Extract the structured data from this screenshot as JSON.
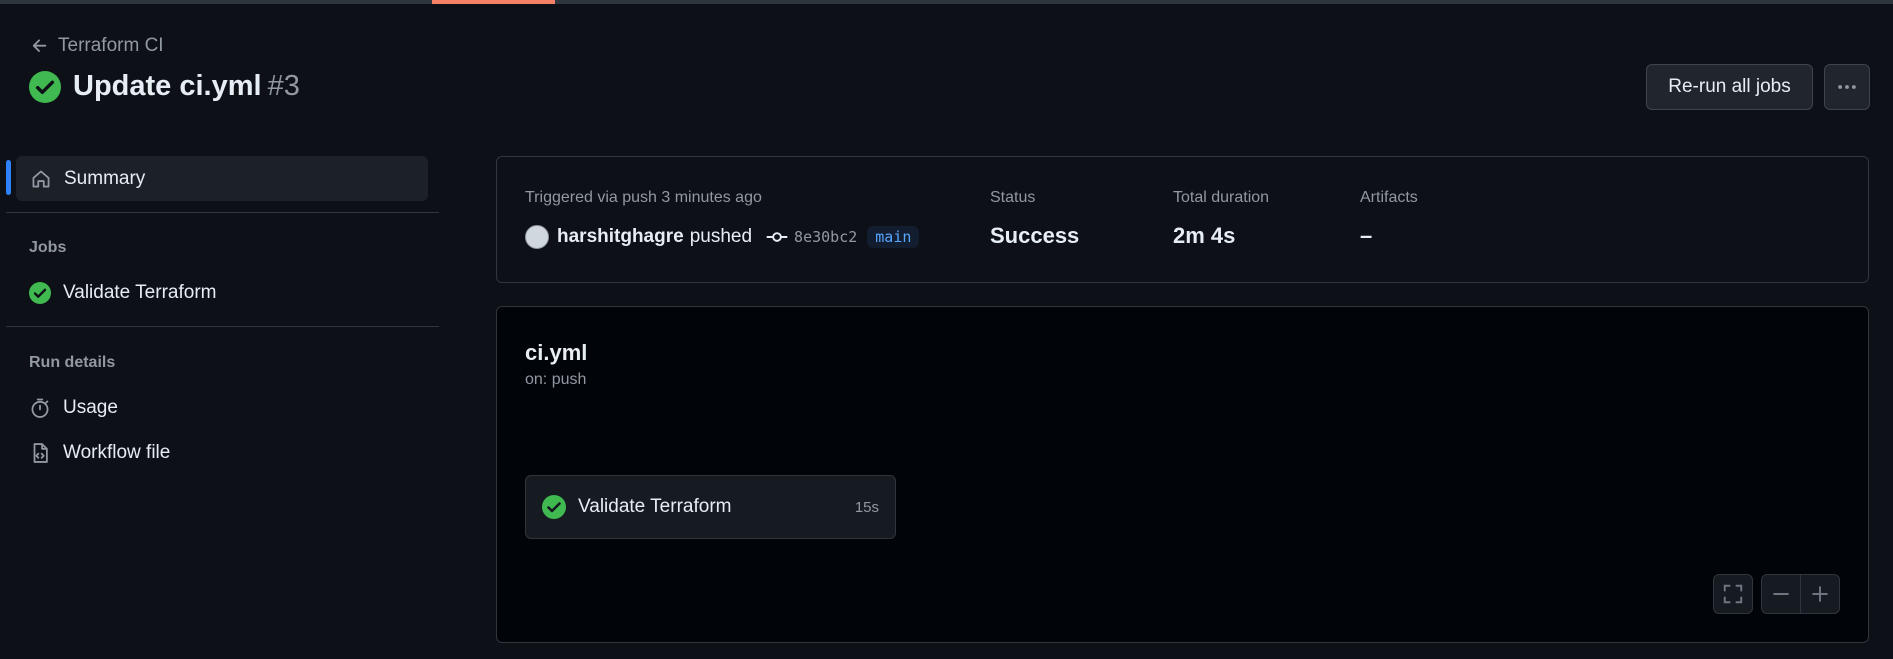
{
  "header": {
    "back_label": "Terraform CI",
    "title": "Update ci.yml",
    "run_number": "#3",
    "rerun_label": "Re-run all jobs"
  },
  "sidebar": {
    "summary_label": "Summary",
    "jobs_heading": "Jobs",
    "jobs": [
      {
        "label": "Validate Terraform",
        "status": "success"
      }
    ],
    "run_details_heading": "Run details",
    "usage_label": "Usage",
    "workflow_file_label": "Workflow file"
  },
  "summary": {
    "trigger_text": "Triggered via push 3 minutes ago",
    "actor": "harshitghagre",
    "action": "pushed",
    "commit_sha": "8e30bc2",
    "branch": "main",
    "status_label": "Status",
    "status_value": "Success",
    "duration_label": "Total duration",
    "duration_value": "2m 4s",
    "artifacts_label": "Artifacts",
    "artifacts_value": "–"
  },
  "workflow": {
    "file": "ci.yml",
    "trigger": "on: push",
    "job": {
      "name": "Validate Terraform",
      "duration": "15s"
    }
  },
  "colors": {
    "background": "#0d1117",
    "success": "#3fb950",
    "accent": "#2f81f7",
    "tab_underline": "#f78166"
  }
}
